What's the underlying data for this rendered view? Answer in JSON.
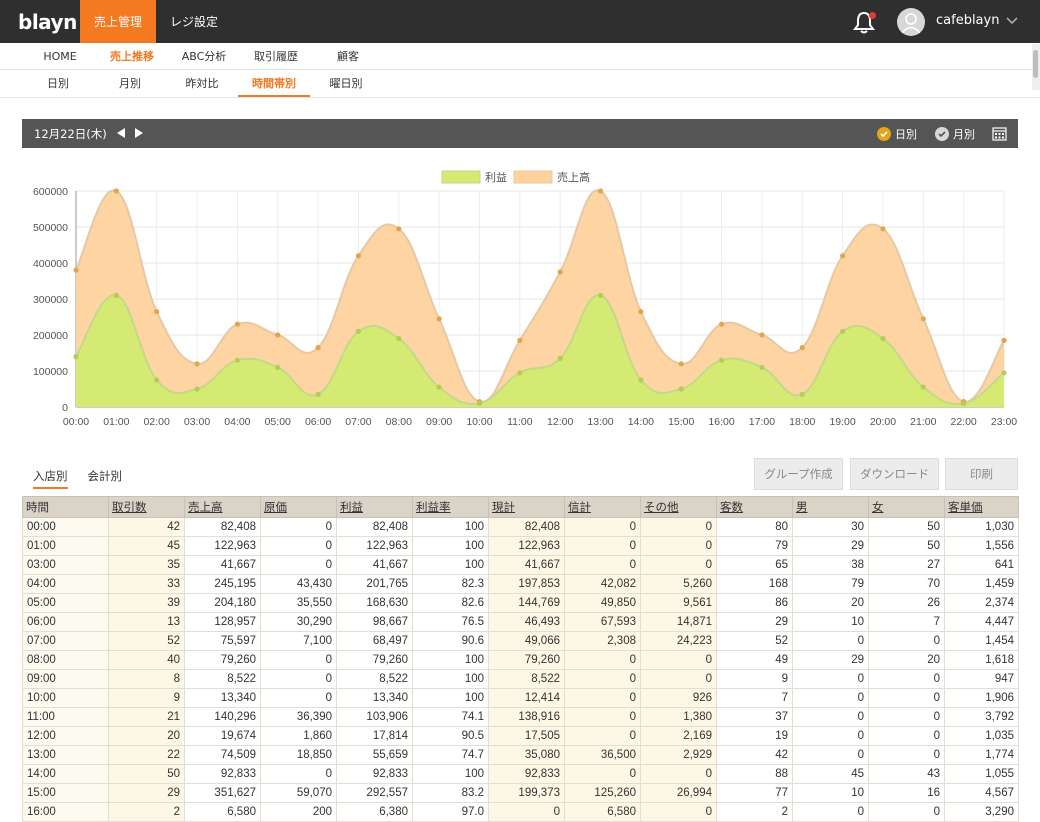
{
  "app": {
    "logo": "blayn",
    "nav": [
      "売上管理",
      "レジ設定"
    ],
    "user": "cafeblayn"
  },
  "subnav1": [
    "HOME",
    "売上推移",
    "ABC分析",
    "取引履歴",
    "顧客"
  ],
  "subnav2": [
    "日別",
    "月別",
    "昨対比",
    "時間帯別",
    "曜日別"
  ],
  "datebar": {
    "date": "12月22日(木)",
    "opt_day": "日別",
    "opt_month": "月別"
  },
  "colors": {
    "profit_fill": "#d4ea72",
    "sales_fill": "#fdd29d",
    "accent": "#f47920"
  },
  "chart_data": {
    "type": "area",
    "x": [
      "00:00",
      "01:00",
      "02:00",
      "03:00",
      "04:00",
      "05:00",
      "06:00",
      "07:00",
      "08:00",
      "09:00",
      "10:00",
      "11:00",
      "12:00",
      "13:00",
      "14:00",
      "15:00",
      "16:00",
      "17:00",
      "18:00",
      "19:00",
      "20:00",
      "21:00",
      "22:00",
      "23:00"
    ],
    "ylim": [
      0,
      600000
    ],
    "yticks": [
      "0",
      "100000",
      "200000",
      "300000",
      "400000",
      "500000",
      "600000"
    ],
    "series": [
      {
        "name": "利益",
        "values": [
          140000,
          310000,
          75000,
          50000,
          130000,
          110000,
          35000,
          210000,
          190000,
          55000,
          10000,
          95000,
          135000,
          310000,
          75000,
          50000,
          130000,
          110000,
          35000,
          210000,
          190000,
          55000,
          10000,
          95000
        ]
      },
      {
        "name": "売上高",
        "values": [
          380000,
          600000,
          265000,
          120000,
          230000,
          200000,
          165000,
          420000,
          495000,
          245000,
          15000,
          185000,
          375000,
          600000,
          265000,
          120000,
          230000,
          200000,
          165000,
          420000,
          495000,
          245000,
          15000,
          185000
        ]
      }
    ],
    "grid": true,
    "legend": "top-center"
  },
  "tabs": [
    "入店別",
    "会計別"
  ],
  "buttons": [
    "グループ作成",
    "ダウンロード",
    "印刷"
  ],
  "table": {
    "headers": [
      "時間",
      "取引数",
      "売上高",
      "原価",
      "利益",
      "利益率",
      "現計",
      "信計",
      "その他",
      "客数",
      "男",
      "女",
      "客単価"
    ],
    "rows": [
      [
        "00:00",
        "42",
        "82,408",
        "0",
        "82,408",
        "100",
        "82,408",
        "0",
        "0",
        "80",
        "30",
        "50",
        "1,030"
      ],
      [
        "01:00",
        "45",
        "122,963",
        "0",
        "122,963",
        "100",
        "122,963",
        "0",
        "0",
        "79",
        "29",
        "50",
        "1,556"
      ],
      [
        "03:00",
        "35",
        "41,667",
        "0",
        "41,667",
        "100",
        "41,667",
        "0",
        "0",
        "65",
        "38",
        "27",
        "641"
      ],
      [
        "04:00",
        "33",
        "245,195",
        "43,430",
        "201,765",
        "82.3",
        "197,853",
        "42,082",
        "5,260",
        "168",
        "79",
        "70",
        "1,459"
      ],
      [
        "05:00",
        "39",
        "204,180",
        "35,550",
        "168,630",
        "82.6",
        "144,769",
        "49,850",
        "9,561",
        "86",
        "20",
        "26",
        "2,374"
      ],
      [
        "06:00",
        "13",
        "128,957",
        "30,290",
        "98,667",
        "76.5",
        "46,493",
        "67,593",
        "14,871",
        "29",
        "10",
        "7",
        "4,447"
      ],
      [
        "07:00",
        "52",
        "75,597",
        "7,100",
        "68,497",
        "90.6",
        "49,066",
        "2,308",
        "24,223",
        "52",
        "0",
        "0",
        "1,454"
      ],
      [
        "08:00",
        "40",
        "79,260",
        "0",
        "79,260",
        "100",
        "79,260",
        "0",
        "0",
        "49",
        "29",
        "20",
        "1,618"
      ],
      [
        "09:00",
        "8",
        "8,522",
        "0",
        "8,522",
        "100",
        "8,522",
        "0",
        "0",
        "9",
        "0",
        "0",
        "947"
      ],
      [
        "10:00",
        "9",
        "13,340",
        "0",
        "13,340",
        "100",
        "12,414",
        "0",
        "926",
        "7",
        "0",
        "0",
        "1,906"
      ],
      [
        "11:00",
        "21",
        "140,296",
        "36,390",
        "103,906",
        "74.1",
        "138,916",
        "0",
        "1,380",
        "37",
        "0",
        "0",
        "3,792"
      ],
      [
        "12:00",
        "20",
        "19,674",
        "1,860",
        "17,814",
        "90.5",
        "17,505",
        "0",
        "2,169",
        "19",
        "0",
        "0",
        "1,035"
      ],
      [
        "13:00",
        "22",
        "74,509",
        "18,850",
        "55,659",
        "74.7",
        "35,080",
        "36,500",
        "2,929",
        "42",
        "0",
        "0",
        "1,774"
      ],
      [
        "14:00",
        "50",
        "92,833",
        "0",
        "92,833",
        "100",
        "92,833",
        "0",
        "0",
        "88",
        "45",
        "43",
        "1,055"
      ],
      [
        "15:00",
        "29",
        "351,627",
        "59,070",
        "292,557",
        "83.2",
        "199,373",
        "125,260",
        "26,994",
        "77",
        "10",
        "16",
        "4,567"
      ],
      [
        "16:00",
        "2",
        "6,580",
        "200",
        "6,380",
        "97.0",
        "0",
        "6,580",
        "0",
        "2",
        "0",
        "0",
        "3,290"
      ]
    ]
  }
}
